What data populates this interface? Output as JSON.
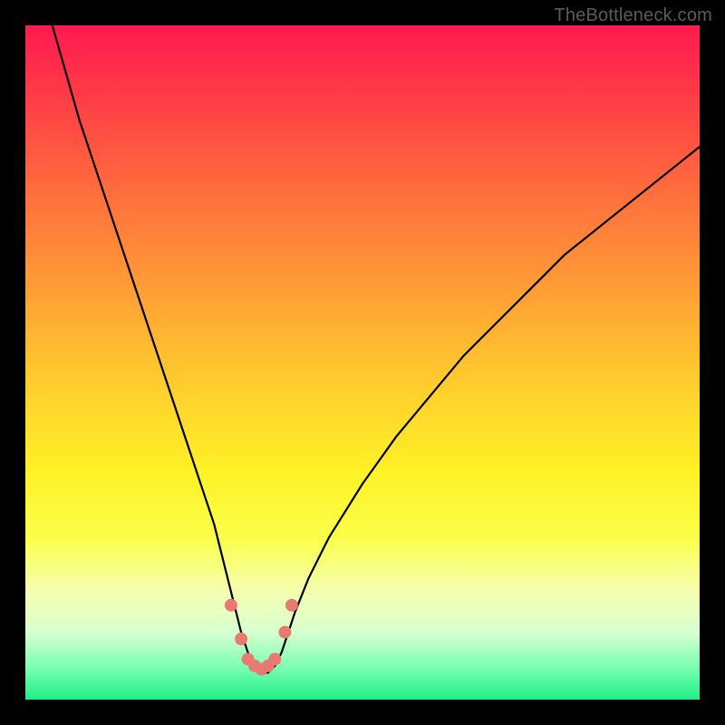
{
  "watermark": "TheBottleneck.com",
  "chart_data": {
    "type": "line",
    "title": "",
    "xlabel": "",
    "ylabel": "",
    "xlim": [
      0,
      100
    ],
    "ylim": [
      0,
      100
    ],
    "series": [
      {
        "name": "bottleneck-curve",
        "x": [
          4,
          6,
          8,
          10,
          12,
          14,
          16,
          18,
          20,
          22,
          24,
          26,
          28,
          29,
          30,
          31,
          32,
          33,
          34,
          35,
          36,
          37,
          38,
          39,
          40,
          42,
          45,
          50,
          55,
          60,
          65,
          70,
          75,
          80,
          85,
          90,
          95,
          100
        ],
        "y": [
          100,
          93,
          86,
          80,
          74,
          68,
          62,
          56,
          50,
          44,
          38,
          32,
          26,
          22,
          18,
          14,
          10,
          7,
          5,
          4,
          4,
          5,
          7,
          10,
          13,
          18,
          24,
          32,
          39,
          45,
          51,
          56,
          61,
          66,
          70,
          74,
          78,
          82
        ]
      }
    ],
    "markers": {
      "name": "data-points",
      "x": [
        30.5,
        32,
        33,
        34,
        35,
        36,
        37,
        38.5,
        39.5
      ],
      "y": [
        14,
        9,
        6,
        5,
        4.5,
        5,
        6,
        10,
        14
      ]
    }
  }
}
